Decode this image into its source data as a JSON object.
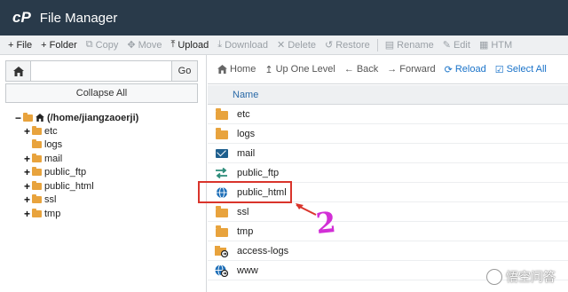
{
  "header": {
    "logo": "cP",
    "title": "File Manager"
  },
  "toolbar": {
    "items": [
      {
        "icon": "+",
        "label": "File",
        "disabled": false
      },
      {
        "icon": "+",
        "label": "Folder",
        "disabled": false
      },
      {
        "icon": "⧉",
        "label": "Copy",
        "disabled": true
      },
      {
        "icon": "✥",
        "label": "Move",
        "disabled": true
      },
      {
        "icon": "⤒",
        "label": "Upload",
        "disabled": false
      },
      {
        "icon": "⤓",
        "label": "Download",
        "disabled": true
      },
      {
        "icon": "✕",
        "label": "Delete",
        "disabled": true
      },
      {
        "icon": "↺",
        "label": "Restore",
        "disabled": true
      },
      {
        "icon": "▤",
        "label": "Rename",
        "disabled": true
      },
      {
        "icon": "✎",
        "label": "Edit",
        "disabled": true
      },
      {
        "icon": "▦",
        "label": "HTM",
        "disabled": true
      }
    ]
  },
  "sidebar": {
    "go_label": "Go",
    "path_value": "",
    "collapse_label": "Collapse All",
    "tree": [
      {
        "label": "(/home/jiangzaoerji)",
        "expander": "−",
        "root": true
      },
      {
        "label": "etc",
        "expander": "+"
      },
      {
        "label": "logs",
        "expander": ""
      },
      {
        "label": "mail",
        "expander": "+"
      },
      {
        "label": "public_ftp",
        "expander": "+"
      },
      {
        "label": "public_html",
        "expander": "+"
      },
      {
        "label": "ssl",
        "expander": "+"
      },
      {
        "label": "tmp",
        "expander": "+"
      }
    ]
  },
  "nav": {
    "home": "Home",
    "up": "Up One Level",
    "back": "Back",
    "forward": "Forward",
    "reload": "Reload",
    "select_all": "Select All"
  },
  "list": {
    "column_name": "Name",
    "rows": [
      {
        "name": "etc",
        "icon": "folder-icon"
      },
      {
        "name": "logs",
        "icon": "folder-icon"
      },
      {
        "name": "mail",
        "icon": "mail-icon"
      },
      {
        "name": "public_ftp",
        "icon": "ftp-arrows-icon"
      },
      {
        "name": "public_html",
        "icon": "globe-icon"
      },
      {
        "name": "ssl",
        "icon": "folder-icon"
      },
      {
        "name": "tmp",
        "icon": "folder-icon"
      },
      {
        "name": "access-logs",
        "icon": "folder-link-icon"
      },
      {
        "name": "www",
        "icon": "globe-link-icon"
      }
    ]
  },
  "annotation": {
    "number": "2",
    "color": "#d22fd6",
    "box_color": "#d9342b"
  },
  "watermark": {
    "text": "悟空问答"
  },
  "colors": {
    "header_bg": "#293a4a",
    "accent": "#1a73c9",
    "folder": "#e8a33d"
  }
}
